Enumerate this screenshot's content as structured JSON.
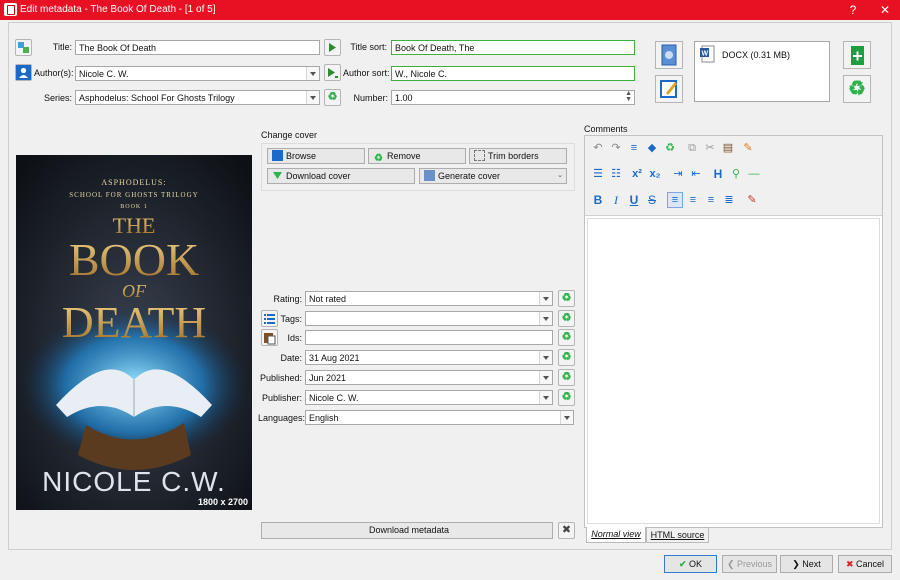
{
  "window": {
    "title": "Edit metadata - The Book Of Death - [1 of 5]",
    "help": "?",
    "close": "✕"
  },
  "fields": {
    "title_label": "Title:",
    "title_value": "The Book Of Death",
    "title_sort_label": "Title sort:",
    "title_sort_value": "Book Of Death, The",
    "authors_label": "Author(s):",
    "authors_value": "Nicole C. W.",
    "author_sort_label": "Author sort:",
    "author_sort_value": "W., Nicole C.",
    "series_label": "Series:",
    "series_value": "Asphodelus: School For Ghosts Trilogy",
    "number_label": "Number:",
    "number_value": "1.00"
  },
  "formats": {
    "entry": "DOCX (0.31 MB)"
  },
  "cover": {
    "section_label": "Change cover",
    "browse": "Browse",
    "remove": "Remove",
    "trim": "Trim borders",
    "download": "Download cover",
    "generate": "Generate cover",
    "size": "1800 x 2700",
    "art_series": "ASPHODELUS:",
    "art_subtitle": "SCHOOL FOR GHOSTS TRILOGY",
    "art_book": "BOOK 1",
    "art_the": "THE",
    "art_book_word": "BOOK",
    "art_of": "OF",
    "art_death": "DEATH",
    "art_author": "NICOLE C.W."
  },
  "meta": {
    "rating_label": "Rating:",
    "rating_value": "Not rated",
    "tags_label": "Tags:",
    "tags_value": "",
    "ids_label": "Ids:",
    "ids_value": "",
    "date_label": "Date:",
    "date_value": "31 Aug 2021",
    "published_label": "Published:",
    "published_value": "Jun 2021",
    "publisher_label": "Publisher:",
    "publisher_value": "Nicole C. W.",
    "languages_label": "Languages:",
    "languages_value": "English"
  },
  "comments": {
    "label": "Comments",
    "tab_normal": "Normal view",
    "tab_html": "HTML source"
  },
  "download_metadata": "Download metadata",
  "footer": {
    "ok": "OK",
    "previous": "Previous",
    "next": "Next",
    "cancel": "Cancel"
  },
  "colors": {
    "titlebar": "#e81123",
    "accent_green": "#2eb34a",
    "accent_blue": "#1b6ac9"
  }
}
